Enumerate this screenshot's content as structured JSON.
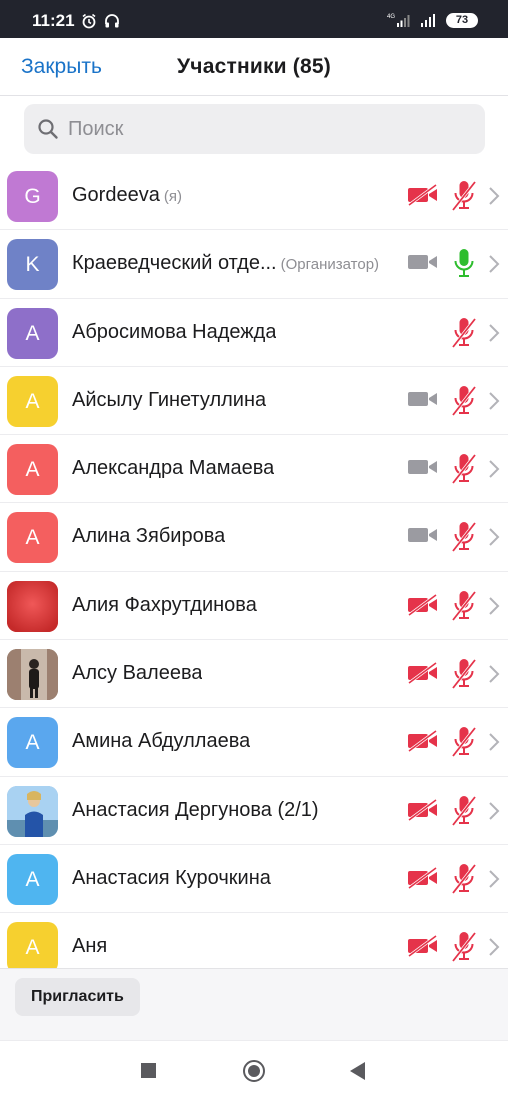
{
  "status_bar": {
    "time": "11:21",
    "network": "4G",
    "battery": "73"
  },
  "header": {
    "close_label": "Закрыть",
    "title": "Участники (85)"
  },
  "search": {
    "placeholder": "Поиск"
  },
  "colors": {
    "accent": "#1a73c8",
    "mic_active": "#2ebd2e",
    "muted_red": "#e5334a",
    "video_on_gray": "#9b9ba1"
  },
  "participants": [
    {
      "name": "Gordeeva",
      "tag": "(я)",
      "avatar_letter": "G",
      "avatar_color": "#c079d3",
      "video": "off",
      "mic": "muted"
    },
    {
      "name": "Краеведческий отде...",
      "tag": "(Организатор)",
      "avatar_letter": "K",
      "avatar_color": "#6f82c7",
      "video": "on",
      "mic": "active"
    },
    {
      "name": "Абросимова Надежда",
      "tag": "",
      "avatar_letter": "A",
      "avatar_color": "#8e6fc9",
      "video": "none",
      "mic": "muted"
    },
    {
      "name": "Айсылу Гинетуллина",
      "tag": "",
      "avatar_letter": "A",
      "avatar_color": "#f6d02f",
      "video": "on",
      "mic": "muted"
    },
    {
      "name": "Александра Мамаева",
      "tag": "",
      "avatar_letter": "A",
      "avatar_color": "#f45f5f",
      "video": "on",
      "mic": "muted"
    },
    {
      "name": "Алина Зябирова",
      "tag": "",
      "avatar_letter": "A",
      "avatar_color": "#f45f5f",
      "video": "on",
      "mic": "muted"
    },
    {
      "name": "Алия Фахрутдинова",
      "tag": "",
      "avatar_letter": "",
      "avatar_color": "#e23a3a",
      "avatar_kind": "photo-red",
      "video": "off",
      "mic": "muted"
    },
    {
      "name": "Алсу Валеева",
      "tag": "",
      "avatar_letter": "",
      "avatar_color": "#8a6d58",
      "avatar_kind": "photo-person",
      "video": "off",
      "mic": "muted"
    },
    {
      "name": "Амина Абдуллаева",
      "tag": "",
      "avatar_letter": "A",
      "avatar_color": "#5aa7ee",
      "video": "off",
      "mic": "muted"
    },
    {
      "name": "Анастасия Дергунова (2/1)",
      "tag": "",
      "avatar_letter": "",
      "avatar_color": "#8fbbe0",
      "avatar_kind": "photo-sky",
      "video": "off",
      "mic": "muted"
    },
    {
      "name": "Анастасия Курочкина",
      "tag": "",
      "avatar_letter": "A",
      "avatar_color": "#4fb5f0",
      "video": "off",
      "mic": "muted"
    },
    {
      "name": "Аня",
      "tag": "",
      "avatar_letter": "A",
      "avatar_color": "#f6d02f",
      "video": "off",
      "mic": "muted"
    }
  ],
  "bottom": {
    "invite_label": "Пригласить"
  }
}
